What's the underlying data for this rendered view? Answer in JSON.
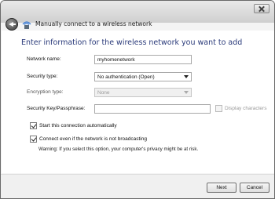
{
  "window": {
    "title": "Manually connect to a wireless network"
  },
  "icons": {
    "back": "back-arrow-icon",
    "network": "wireless-network-icon",
    "close": "close-icon"
  },
  "content": {
    "heading": "Enter information for the wireless network you want to add"
  },
  "form": {
    "network_name": {
      "label": "Network name:",
      "value": "myhomenetwork"
    },
    "security_type": {
      "label": "Security type:",
      "value": "No authentication (Open)"
    },
    "encryption_type": {
      "label": "Encryption type:",
      "value": "None"
    },
    "security_key": {
      "label": "Security Key/Passphrase:",
      "value": ""
    },
    "display_characters": {
      "label": "Display characters",
      "checked": false
    },
    "start_automatically": {
      "label": "Start this connection automatically",
      "checked": true
    },
    "connect_even": {
      "label": "Connect even if the network is not broadcasting",
      "checked": true
    },
    "warning": "Warning: If you select this option, your computer's privacy might be at risk."
  },
  "buttons": {
    "next": "Next",
    "cancel": "Cancel"
  }
}
